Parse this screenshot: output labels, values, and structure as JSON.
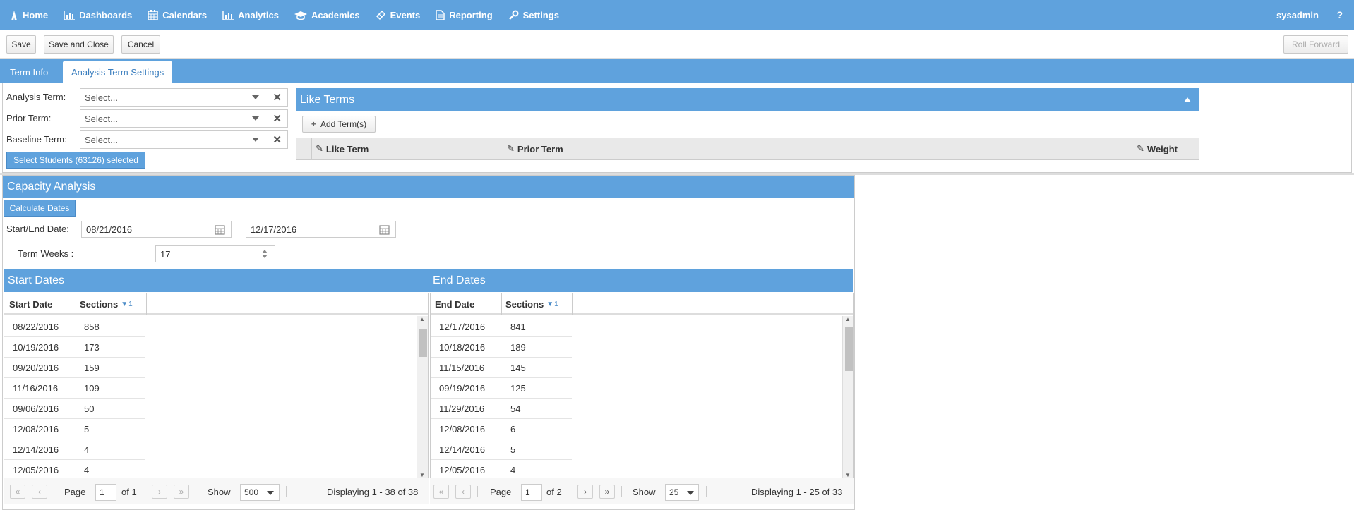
{
  "nav": {
    "items": [
      {
        "label": "Home",
        "icon": "home-icon"
      },
      {
        "label": "Dashboards",
        "icon": "bar-chart-icon"
      },
      {
        "label": "Calendars",
        "icon": "calendar-icon"
      },
      {
        "label": "Analytics",
        "icon": "bar-chart-icon"
      },
      {
        "label": "Academics",
        "icon": "graduation-cap-icon"
      },
      {
        "label": "Events",
        "icon": "ticket-icon"
      },
      {
        "label": "Reporting",
        "icon": "document-icon"
      },
      {
        "label": "Settings",
        "icon": "wrench-icon"
      }
    ],
    "user": "sysadmin",
    "help": "?"
  },
  "toolbar": {
    "save": "Save",
    "save_close": "Save and Close",
    "cancel": "Cancel",
    "roll_forward": "Roll Forward"
  },
  "tabs": {
    "term_info": "Term Info",
    "analysis_settings": "Analysis Term Settings"
  },
  "form": {
    "analysis_term_label": "Analysis Term:",
    "prior_term_label": "Prior Term:",
    "baseline_term_label": "Baseline Term:",
    "select_placeholder": "Select...",
    "select_students": "Select Students (63126) selected"
  },
  "like_terms": {
    "title": "Like Terms",
    "add_button": "Add Term(s)",
    "col_like_term": "Like Term",
    "col_prior_term": "Prior Term",
    "col_weight": "Weight"
  },
  "capacity": {
    "title": "Capacity Analysis",
    "calculate": "Calculate Dates",
    "start_end_label": "Start/End Date:",
    "start_date": "08/21/2016",
    "end_date": "12/17/2016",
    "term_weeks_label": "Term Weeks :",
    "term_weeks": "17"
  },
  "start_dates": {
    "title": "Start Dates",
    "col_date": "Start Date",
    "col_sections": "Sections",
    "sort_index": "1",
    "rows": [
      {
        "date": "08/22/2016",
        "sections": "858"
      },
      {
        "date": "10/19/2016",
        "sections": "173"
      },
      {
        "date": "09/20/2016",
        "sections": "159"
      },
      {
        "date": "11/16/2016",
        "sections": "109"
      },
      {
        "date": "09/06/2016",
        "sections": "50"
      },
      {
        "date": "12/08/2016",
        "sections": "5"
      },
      {
        "date": "12/14/2016",
        "sections": "4"
      },
      {
        "date": "12/05/2016",
        "sections": "4"
      }
    ],
    "pager": {
      "page_label": "Page",
      "page": "1",
      "of": "of 1",
      "show_label": "Show",
      "show": "500",
      "display": "Displaying 1 - 38 of 38"
    }
  },
  "end_dates": {
    "title": "End Dates",
    "col_date": "End Date",
    "col_sections": "Sections",
    "sort_index": "1",
    "rows": [
      {
        "date": "12/17/2016",
        "sections": "841"
      },
      {
        "date": "10/18/2016",
        "sections": "189"
      },
      {
        "date": "11/15/2016",
        "sections": "145"
      },
      {
        "date": "09/19/2016",
        "sections": "125"
      },
      {
        "date": "11/29/2016",
        "sections": "54"
      },
      {
        "date": "12/08/2016",
        "sections": "6"
      },
      {
        "date": "12/14/2016",
        "sections": "5"
      },
      {
        "date": "12/05/2016",
        "sections": "4"
      }
    ],
    "pager": {
      "page_label": "Page",
      "page": "1",
      "of": "of 2",
      "show_label": "Show",
      "show": "25",
      "display": "Displaying 1 - 25 of 33"
    }
  }
}
